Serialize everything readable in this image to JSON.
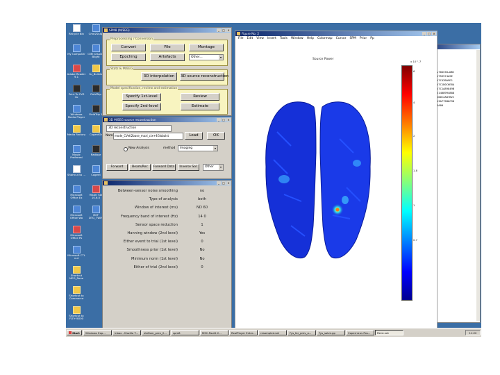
{
  "desktop": {
    "icons": [
      {
        "label": "Recycle Bin",
        "col": 0,
        "row": 0,
        "style": "w"
      },
      {
        "label": "Cme2Snap",
        "col": 1,
        "row": 0,
        "style": "b"
      },
      {
        "label": "My Computer",
        "col": 0,
        "row": 1,
        "style": "b"
      },
      {
        "label": "CME Display Blight",
        "col": 1,
        "row": 1,
        "style": "b"
      },
      {
        "label": "Adobe Reader 9.1",
        "col": 0,
        "row": 2,
        "style": "r"
      },
      {
        "label": "fsl_Bullets",
        "col": 1,
        "row": 2,
        "style": "y"
      },
      {
        "label": "Print To CVS nu",
        "col": 0,
        "row": 3,
        "style": "d"
      },
      {
        "label": "FieldTrip",
        "col": 1,
        "row": 3,
        "style": "d"
      },
      {
        "label": "Windows Media Player",
        "col": 0,
        "row": 4,
        "style": "b"
      },
      {
        "label": "FieldTrip 1",
        "col": 1,
        "row": 4,
        "style": "d"
      },
      {
        "label": "Media Factory",
        "col": 0,
        "row": 5,
        "style": "y"
      },
      {
        "label": "CogentGr",
        "col": 1,
        "row": 5,
        "style": "y"
      },
      {
        "label": "Nlogic Preferred",
        "col": 0,
        "row": 6,
        "style": "b"
      },
      {
        "label": "Radiogr",
        "col": 1,
        "row": 6,
        "style": "d"
      },
      {
        "label": "Shortcut to ...",
        "col": 0,
        "row": 7,
        "style": "w"
      },
      {
        "label": "Cogent",
        "col": 1,
        "row": 7,
        "style": "b"
      },
      {
        "label": "Microsoft Office Ex",
        "col": 0,
        "row": 8,
        "style": "b"
      },
      {
        "label": "Yester Ste 10.6.0",
        "col": 1,
        "row": 8,
        "style": "r"
      },
      {
        "label": "Microsoft Office Wo",
        "col": 0,
        "row": 9,
        "style": "b"
      },
      {
        "label": "MEF DTG_TWIN",
        "col": 1,
        "row": 9,
        "style": "b"
      },
      {
        "label": "Microsoft Office Po",
        "col": 0,
        "row": 10,
        "style": "r"
      },
      {
        "label": "Microsoft CTL nut",
        "col": 0,
        "row": 11,
        "style": "b"
      },
      {
        "label": "Shortcut MEG_Rone",
        "col": 0,
        "row": 12,
        "style": "y"
      },
      {
        "label": "Shortcut to Commerce",
        "col": 0,
        "row": 13,
        "style": "y"
      },
      {
        "label": "Shortcut to FIZ+f4000",
        "col": 0,
        "row": 14,
        "style": "y"
      }
    ]
  },
  "spm_menu": {
    "title": "SPM8 (M/EEG)",
    "group1_label": "Preprocessing / Conversion",
    "group2_label": "Stats & M/EEG",
    "group3_label": "Model specification, review and estimation",
    "buttons": {
      "convert": "Convert",
      "file": "File",
      "montage": "Montage",
      "epoching": "Epoching",
      "artefacts": "Artefacts",
      "other": "Other...",
      "interpolation_3d": "3D interpolation",
      "source_reconstruction_3d": "3D source reconstruction",
      "specify_1st_level": "Specify 1st-level",
      "review": "Review",
      "specify_2nd_level": "Specify 2nd-level",
      "estimate": "Estimate"
    }
  },
  "recon_dialog": {
    "title": "3D M/EEG source reconstruction",
    "header": "3D reconstruction",
    "file_label": "Name:",
    "file_value": "mode_CVetl2base_maxi_ctx+4Globalst",
    "load_label": "Load",
    "ok_label": "OK",
    "analysis_radio": "New Analysis",
    "method_label": "method",
    "method_value": "Imaging",
    "tabs": [
      "Forward",
      "Beam/Rec",
      "Forward Data",
      "Inverse Sol.",
      "Other"
    ]
  },
  "params": {
    "rows": [
      {
        "label": "Between-sensor noise smoothing",
        "value": "no"
      },
      {
        "label": "Type of analysis",
        "value": "both"
      },
      {
        "label": "Window of interest (ms)",
        "value": "ND 60"
      },
      {
        "label": "Frequency band of interest (Hz)",
        "value": "14 0"
      },
      {
        "label": "Sensor space reduction",
        "value": "1"
      },
      {
        "label": "Hanning window (2nd level)",
        "value": "Yes"
      },
      {
        "label": "Either event to trial (1st level)",
        "value": "0"
      },
      {
        "label": "Smoothness prior (1st level)",
        "value": "No"
      },
      {
        "label": "Minimum norm (1st level)",
        "value": "No"
      },
      {
        "label": "Either of trial (2nd level)",
        "value": "0"
      }
    ]
  },
  "figure": {
    "title": "Figure No. 2",
    "menu": [
      "File",
      "Edit",
      "View",
      "Insert",
      "Tools",
      "Window",
      "Help",
      "Colormap",
      "Cursor",
      "SPM",
      "Prior",
      "Pp"
    ],
    "plot_title": "Source Power",
    "colorbar_ticks": [
      "6",
      "4",
      "2",
      "1.8",
      "1",
      "0.7"
    ],
    "colorbar_exponent": "x 10^-7"
  },
  "side_window": {
    "lines": [
      "s70GC50+W8C",
      "5759574A9E",
      "57C42BA9E1",
      "57C1D0C6E8A",
      "57C1A89849B",
      "51408994888",
      "50DC2A87B2C",
      "53A775B6C98",
      "8A00"
    ]
  },
  "taskbar": {
    "start_label": "Start",
    "items": [
      "Windows Exp...",
      "Inbox - Mozilla T...",
      "eteflom_prev_2...",
      "spm8",
      "MSC-Paultt 2...",
      "RealPlayer Enter...",
      "resampled.set",
      "Fys_for_prev_a...",
      "Fys_solve.pp",
      "Copernicus Pos...",
      "Paint.net"
    ],
    "active_index": 10,
    "clock": "11:22"
  },
  "colors": {
    "desktop": "#3b6ea5",
    "titlebar_start": "#0a246a",
    "titlebar_end": "#a6caf0",
    "panel": "#d4d0c8",
    "group_bg": "#f8f4c0",
    "group_border": "#9b8f40",
    "brain_base": "#1530d8"
  }
}
